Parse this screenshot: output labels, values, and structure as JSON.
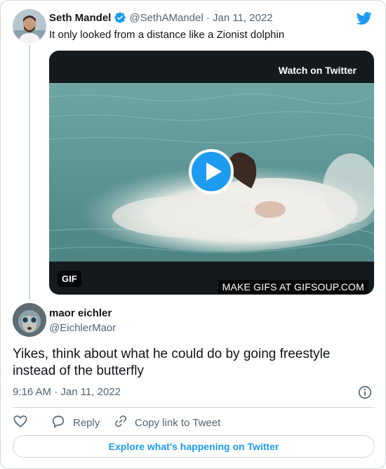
{
  "colors": {
    "accent": "#1d9bf0",
    "text": "#0f1419",
    "muted": "#536471",
    "border": "#cfd9de"
  },
  "quoted_tweet": {
    "author_name": "Seth Mandel",
    "verified_icon": "verified-badge-icon",
    "handle_date": "@SethAMandel · Jan 11, 2022",
    "text": "It only looked from a distance like a Zionist dolphin",
    "media": {
      "watch_label": "Watch on Twitter",
      "gif_badge": "GIF",
      "watermark": "MAKE GIFS AT GIFSOUP.COM",
      "play_icon": "play-icon"
    }
  },
  "reply_tweet": {
    "author_name": "maor eichler",
    "handle": "@EichlerMaor",
    "text": "Yikes, think about what he could do by going freestyle instead of the butterfly",
    "timestamp": "9:16 AM · Jan 11, 2022"
  },
  "actions": {
    "like_icon": "heart-icon",
    "reply_label": "Reply",
    "copy_label": "Copy link to Tweet"
  },
  "explore_label": "Explore what's happening on Twitter",
  "brand_icon": "twitter-bird-icon"
}
